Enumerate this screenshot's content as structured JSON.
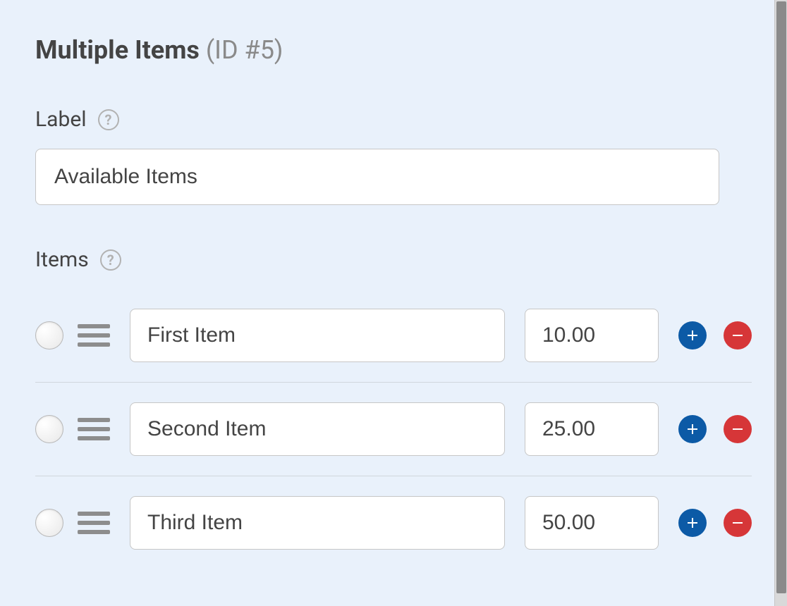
{
  "header": {
    "title": "Multiple Items",
    "id_label": "(ID #5)"
  },
  "label_field": {
    "label": "Label",
    "value": "Available Items",
    "help_symbol": "?"
  },
  "items_field": {
    "label": "Items",
    "help_symbol": "?"
  },
  "items": [
    {
      "name": "First Item",
      "price": "10.00"
    },
    {
      "name": "Second Item",
      "price": "25.00"
    },
    {
      "name": "Third Item",
      "price": "50.00"
    }
  ]
}
